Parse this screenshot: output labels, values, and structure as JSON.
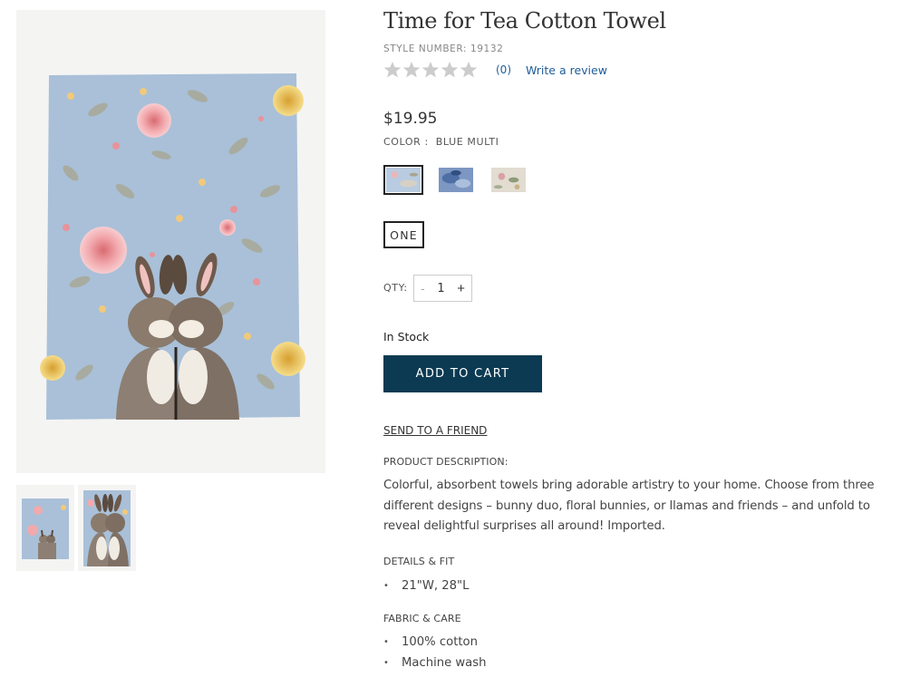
{
  "product": {
    "title": "Time for Tea Cotton Towel",
    "style_number": "STYLE NUMBER: 19132",
    "price": "$19.95",
    "color_label": "COLOR :",
    "color_value": "BLUE MULTI"
  },
  "rating": {
    "stars_filled": 0,
    "stars_total": 5,
    "review_count": "(0)",
    "write_review_label": "Write a review"
  },
  "swatches": [
    {
      "name": "bunny duo",
      "selected": true
    },
    {
      "name": "blue",
      "selected": false
    },
    {
      "name": "beige floral",
      "selected": false
    }
  ],
  "size": {
    "label": "ONE"
  },
  "quantity": {
    "label": "QTY:",
    "minus": "-",
    "value": "1",
    "plus": "+"
  },
  "stock_status": "In Stock",
  "add_to_cart_label": "ADD TO CART",
  "send_to_friend_label": "SEND TO A FRIEND",
  "description": {
    "heading": "PRODUCT DESCRIPTION:",
    "text": "Colorful, absorbent towels bring adorable artistry to your home. Choose from three different designs – bunny duo, floral bunnies, or llamas and friends – and unfold to reveal delightful surprises all around! Imported."
  },
  "details": {
    "heading": "DETAILS & FIT",
    "bullet": "•",
    "items": [
      "21\"W, 28\"L"
    ]
  },
  "fabric": {
    "heading": "FABRIC & CARE",
    "bullet": "•",
    "items": [
      "100% cotton",
      "Machine wash"
    ]
  },
  "colors": {
    "button_bg": "#0b3a52",
    "link": "#1f5c99",
    "towel_blue": "#a9c0d8",
    "star_empty": "#cccccc"
  }
}
